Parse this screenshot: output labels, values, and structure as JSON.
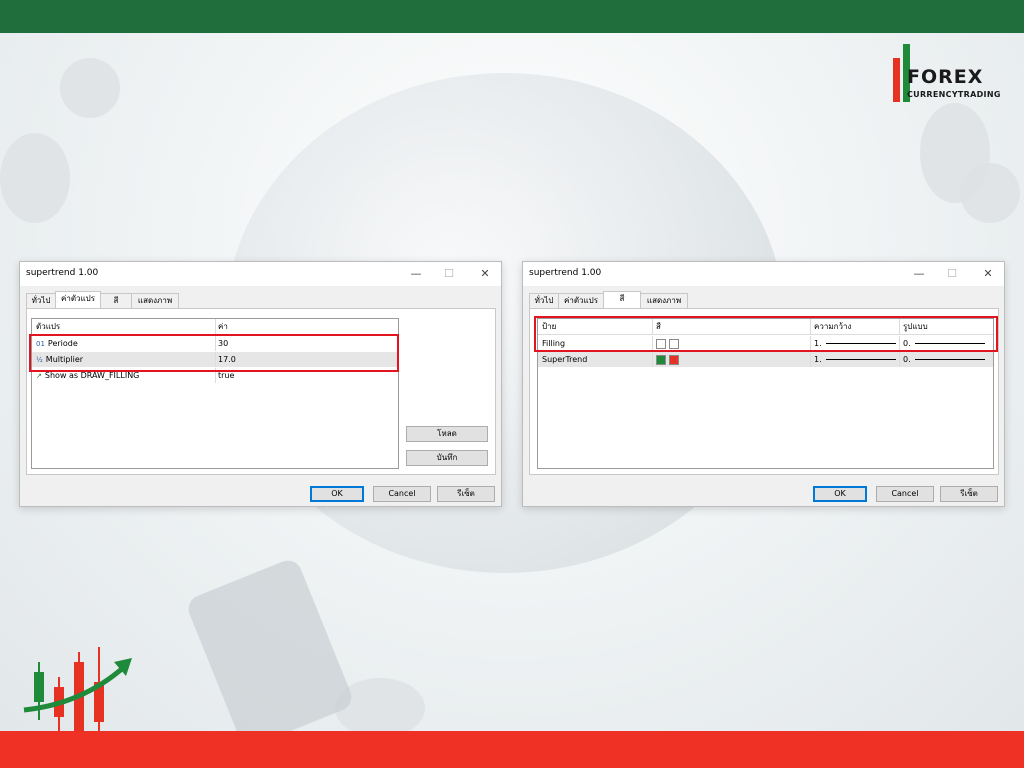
{
  "colors": {
    "top_bar": "#1f6e3c",
    "bottom_bar": "#ef3024",
    "highlight_box": "#e3141f",
    "swatch_green": "#1f8a3a",
    "swatch_red": "#e53223"
  },
  "logo": {
    "title": "FOREX",
    "subtitle": "CURRENCYTRADING"
  },
  "left_dialog": {
    "title": "supertrend 1.00",
    "tabs": [
      "ทั่วไป",
      "ค่าตัวแปร",
      "สี",
      "แสดงภาพ"
    ],
    "active_tab": "ค่าตัวแปร",
    "columns": [
      "ตัวแปร",
      "ค่า"
    ],
    "rows": [
      {
        "icon": "01",
        "name": "Periode",
        "value": "30"
      },
      {
        "icon": "½",
        "name": "Multiplier",
        "value": "17.0"
      },
      {
        "icon": "↗",
        "name": "Show as DRAW_FILLING",
        "value": "true"
      }
    ],
    "side_buttons": {
      "load": "โหลด",
      "save": "บันทึก"
    },
    "footer": {
      "ok": "OK",
      "cancel": "Cancel",
      "reset": "รีเซ็ต"
    }
  },
  "right_dialog": {
    "title": "supertrend 1.00",
    "tabs": [
      "ทั่วไป",
      "ค่าตัวแปร",
      "สี",
      "แสดงภาพ"
    ],
    "active_tab": "สี",
    "columns": [
      "ป้าย",
      "สี",
      "ความกว้าง",
      "รูปแบบ"
    ],
    "rows": [
      {
        "label": "Filling",
        "colors": [
          "#ffffff",
          "#ffffff"
        ],
        "width": "1.",
        "style": "0."
      },
      {
        "label": "SuperTrend",
        "colors": [
          "#1f8a3a",
          "#e53223"
        ],
        "width": "1.",
        "style": "0."
      }
    ],
    "footer": {
      "ok": "OK",
      "cancel": "Cancel",
      "reset": "รีเซ็ต"
    }
  }
}
